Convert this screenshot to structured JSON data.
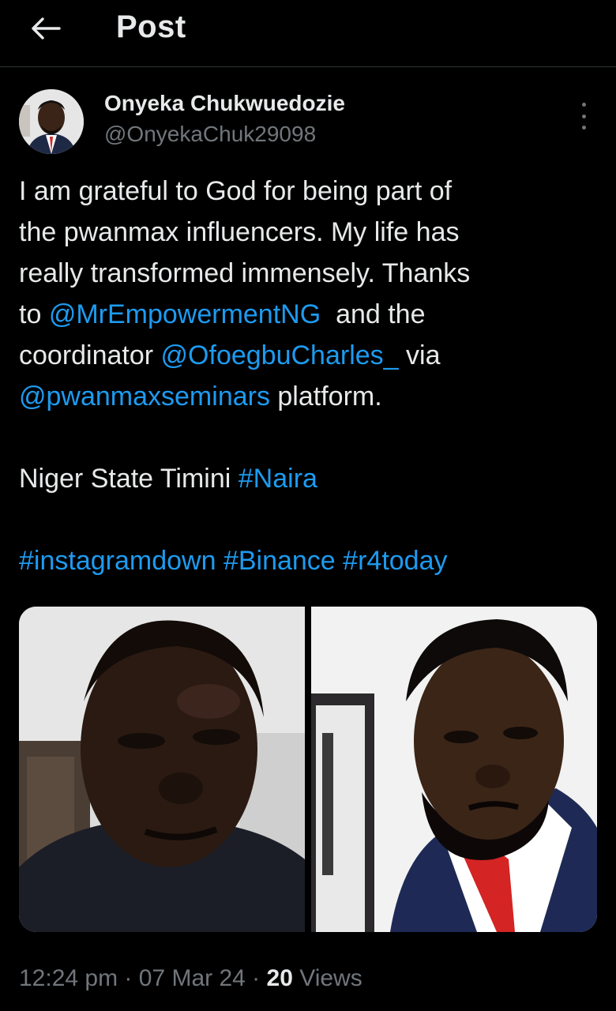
{
  "header": {
    "back_icon": "arrow-left-icon",
    "title": "Post"
  },
  "author": {
    "name": "Onyeka Chukwuedozie",
    "handle": "@OnyekaChuk29098",
    "more_icon": "more-vertical-icon"
  },
  "tweet": {
    "l1": "I am grateful to God for being part of",
    "l2": "the pwanmax influencers. My life has",
    "l3": "really transformed immensely. Thanks",
    "l4_pre": "to ",
    "mention1": "@MrEmpowermentNG",
    "l4_post": "  and the",
    "l5_pre": "coordinator ",
    "mention2": "@OfoegbuCharles_",
    "l5_post": " via",
    "mention3": "@pwanmaxseminars",
    "l6_post": " platform.",
    "l8_pre": "Niger State Timini ",
    "hashtag1": "#Naira",
    "hashtag2": "#instagramdown",
    "hashtag3": "#Binance",
    "hashtag4": "#r4today"
  },
  "meta": {
    "time": "12:24 pm",
    "sep1": " · ",
    "date": "07 Mar 24",
    "sep2": " · ",
    "views_count": "20",
    "views_label": " Views"
  },
  "colors": {
    "background": "#000000",
    "text": "#e7e9ea",
    "muted": "#71767b",
    "link": "#1d9bf0"
  }
}
